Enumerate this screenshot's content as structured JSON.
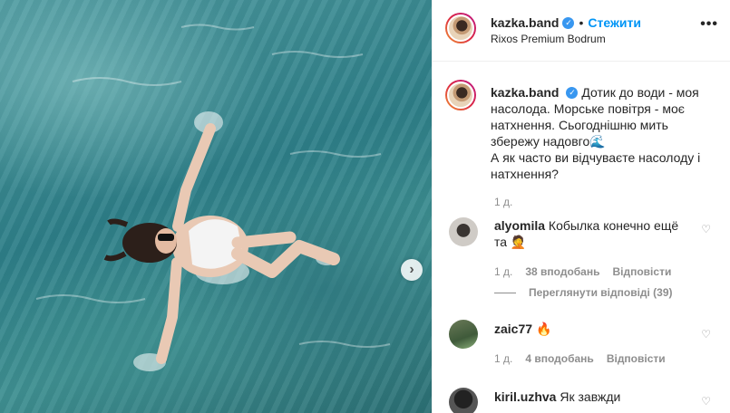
{
  "header": {
    "username": "kazka.band",
    "follow_label": "Стежити",
    "location": "Rixos Premium Bodrum",
    "more": "•••"
  },
  "caption": {
    "username": "kazka.band",
    "text": "Дотик до води - моя насолода. Морське повітря - моє натхнення. Сьогоднішню мить збережу надовго🌊\nА як часто ви відчуваєте насолоду і натхнення?",
    "time": "1 д."
  },
  "comments": [
    {
      "username": "alyomila",
      "text": "Кобылка конечно ещё та 🤦",
      "time": "1 д.",
      "likes": "38 вподобань",
      "reply": "Відповісти",
      "view_replies": "Переглянути відповіді (39)"
    },
    {
      "username": "zaic77",
      "text": "🔥",
      "time": "1 д.",
      "likes": "4 вподобань",
      "reply": "Відповісти"
    },
    {
      "username": "kiril.uzhva",
      "text": "Як завжди"
    }
  ],
  "icons": {
    "verified": "✓",
    "heart": "♡",
    "next": "›"
  },
  "colors": {
    "accent": "#0095f6",
    "muted": "#8e8e8e",
    "text": "#262626"
  }
}
